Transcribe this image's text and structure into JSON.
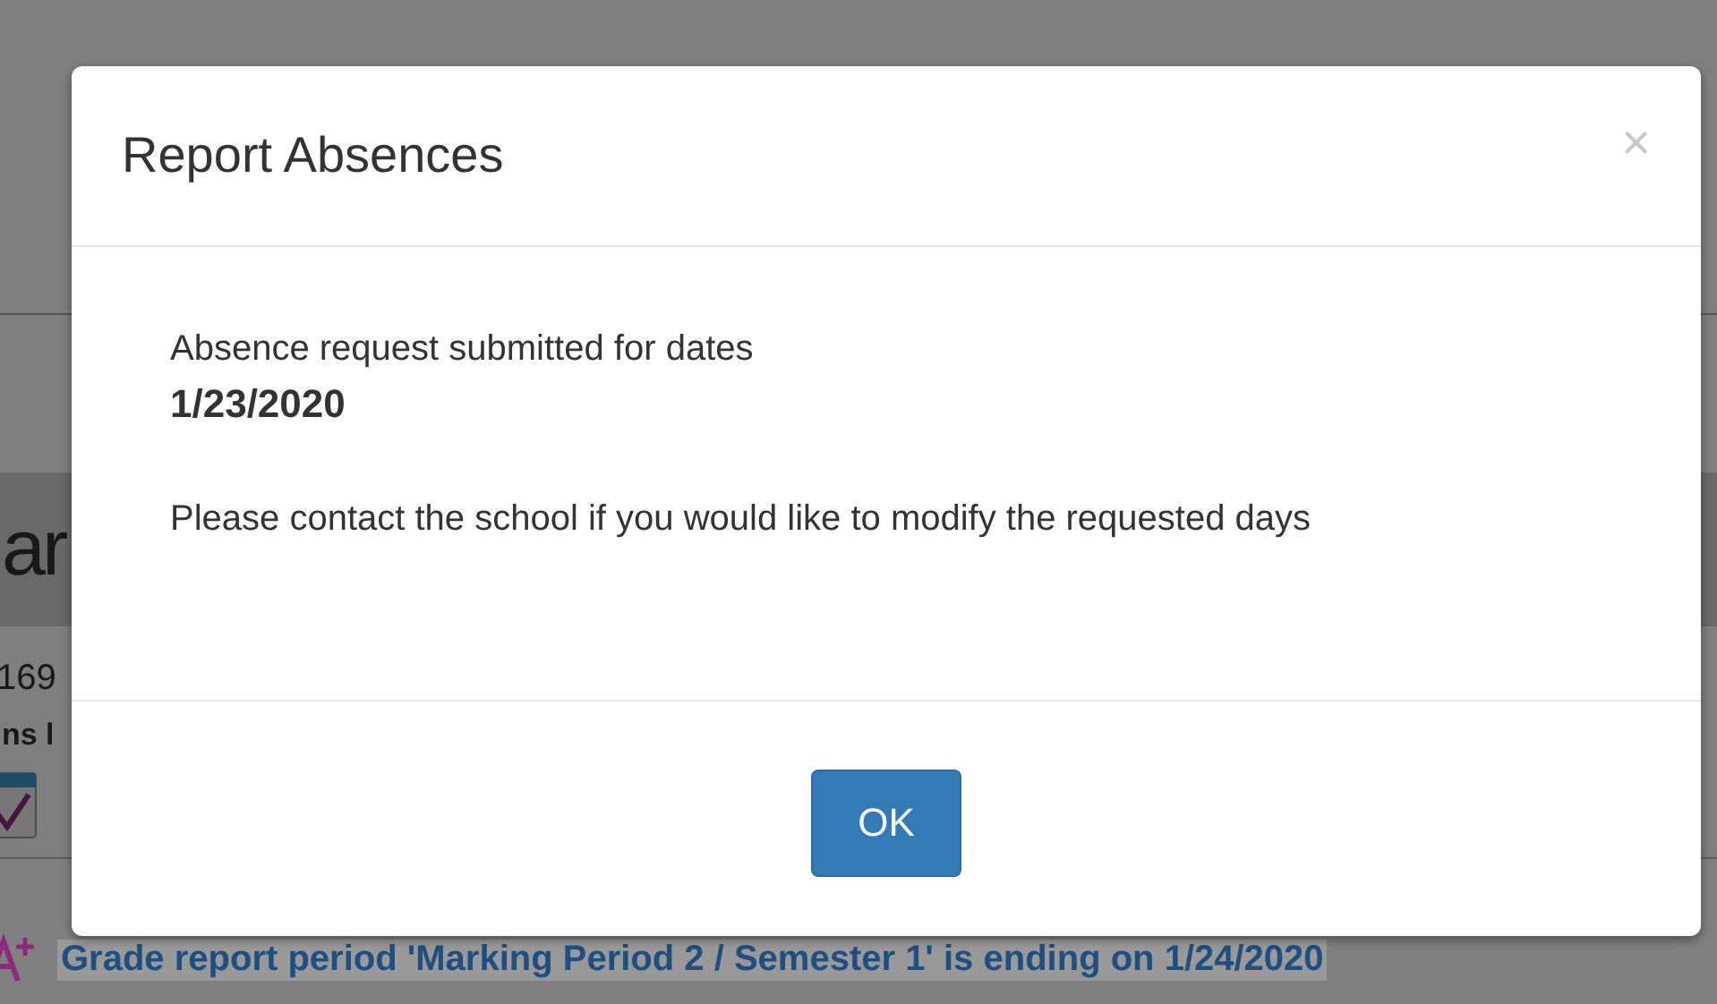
{
  "background": {
    "heading": "ar",
    "lines": [
      "169",
      "ns l"
    ],
    "notice": "Grade report period 'Marking Period 2 / Semester 1' is ending on 1/24/2020"
  },
  "dialog": {
    "title": "Report Absences",
    "close": "×",
    "message": "Absence request submitted for dates",
    "dates": "1/23/2020",
    "note": "Please contact the school if you would like to modify the requested days",
    "buttons": [
      "OK"
    ]
  }
}
